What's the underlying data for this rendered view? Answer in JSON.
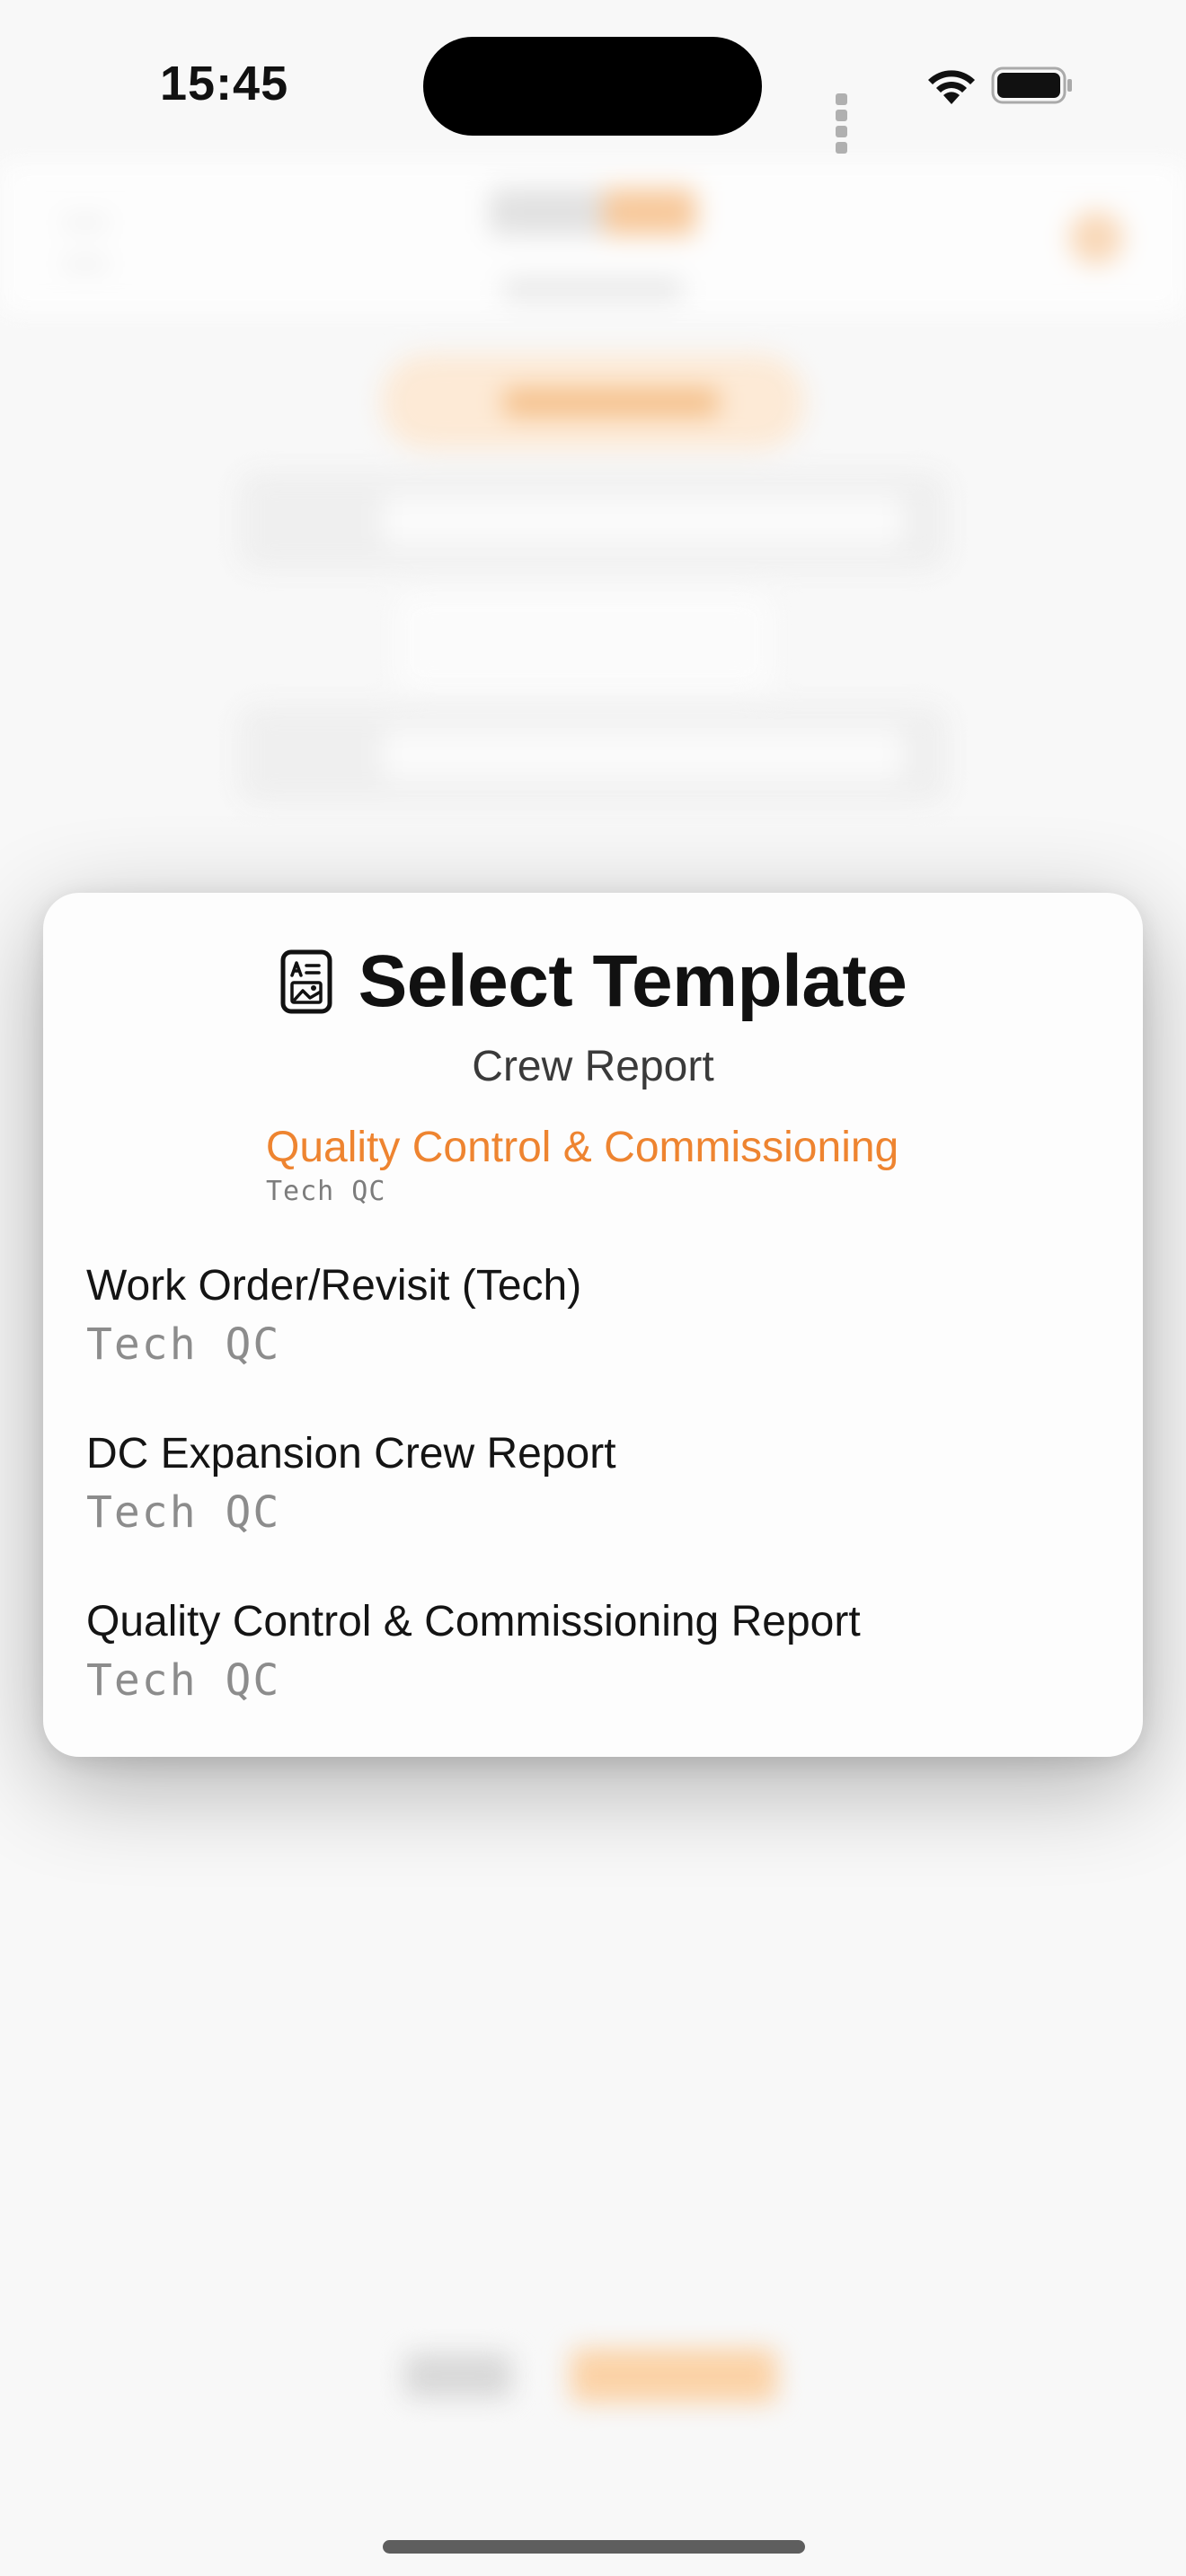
{
  "status_bar": {
    "time": "15:45"
  },
  "modal": {
    "icon": "document-template-icon",
    "title": "Select Template",
    "subtitle": "Crew Report",
    "current": {
      "name": "Quality Control & Commissioning",
      "code": "Tech QC"
    },
    "options": [
      {
        "name": "Work Order/Revisit (Tech)",
        "code": "Tech QC"
      },
      {
        "name": "DC Expansion Crew Report",
        "code": "Tech QC"
      },
      {
        "name": "Quality Control & Commissioning Report",
        "code": "Tech QC"
      }
    ]
  },
  "colors": {
    "accent": "#EE8430",
    "text": "#141414",
    "secondary_text": "#8C8C8C"
  }
}
